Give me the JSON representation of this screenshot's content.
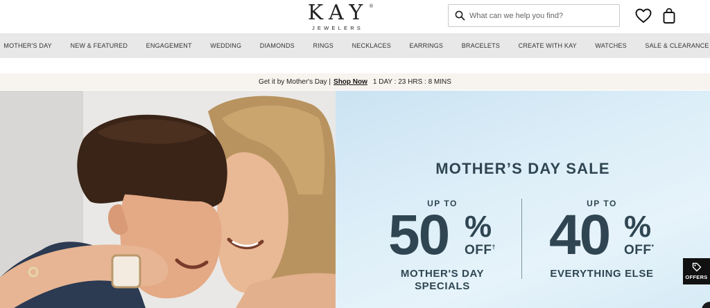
{
  "header": {
    "logo_main": "KAY",
    "logo_sub": "JEWELERS",
    "logo_reg": "®",
    "search_placeholder": "What can we help you find?",
    "icons": [
      "search-icon",
      "heart-icon",
      "shopping-bag-icon"
    ]
  },
  "nav": {
    "items": [
      "MOTHER'S DAY",
      "NEW & FEATURED",
      "ENGAGEMENT",
      "WEDDING",
      "DIAMONDS",
      "RINGS",
      "NECKLACES",
      "EARRINGS",
      "BRACELETS",
      "CREATE WITH KAY",
      "WATCHES",
      "SALE & CLEARANCE"
    ]
  },
  "promo": {
    "text": "Get it by Mother's Day |",
    "link": "Shop Now",
    "countdown": "1 DAY : 23 HRS : 8 MINS"
  },
  "hero": {
    "title": "MOTHER’S DAY SALE",
    "offers": [
      {
        "upto": "UP TO",
        "number": "50",
        "percent": "%",
        "off": "OFF",
        "mark": "†",
        "line1": "MOTHER'S DAY",
        "line2": "SPECIALS"
      },
      {
        "upto": "UP TO",
        "number": "40",
        "percent": "%",
        "off": "OFF",
        "mark": "*",
        "line1": "EVERYTHING ELSE",
        "line2": ""
      }
    ],
    "offers_tab": "OFFERS",
    "colors": {
      "panel": "#d6ebf6",
      "text": "#2f4652"
    }
  }
}
